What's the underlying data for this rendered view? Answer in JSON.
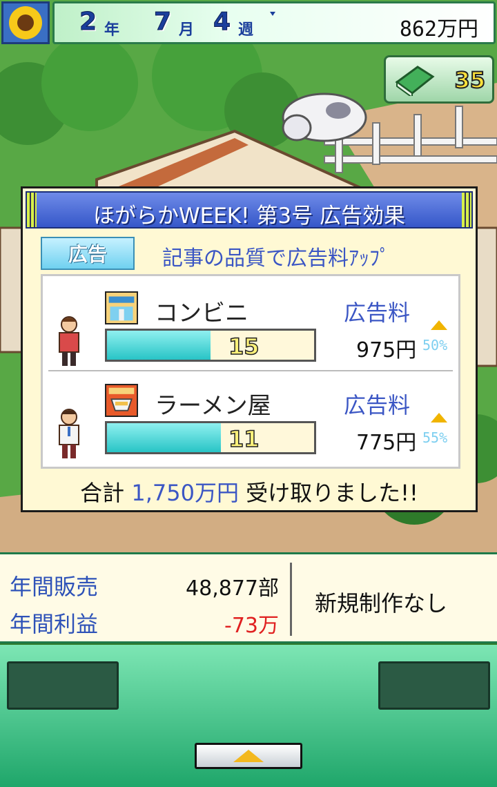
{
  "topbar": {
    "year_num": "2",
    "year_unit": "年",
    "month_num": "7",
    "month_unit": "月",
    "week_num": "4",
    "week_unit": "週",
    "money": "862万円"
  },
  "book_counter": {
    "count": "35",
    "icon": "green-book-icon"
  },
  "dialog": {
    "title": "ほがらかWEEK! 第3号 広告効果",
    "tag": "広告",
    "subtitle": "記事の品質で広告料ｱｯﾌﾟ",
    "rows": [
      {
        "shop": "コンビニ",
        "icon": "convenience-store-icon",
        "fee_label": "広告料",
        "level": "15",
        "level_fill": 0.5,
        "fee": "975円",
        "pct": "50%"
      },
      {
        "shop": "ラーメン屋",
        "icon": "ramen-shop-icon",
        "fee_label": "広告料",
        "level": "11",
        "level_fill": 0.55,
        "fee": "775円",
        "pct": "55%"
      }
    ],
    "total_prefix": "合計",
    "total_amount": "1,750万円",
    "total_suffix": "受け取りました!!"
  },
  "stats": {
    "annual_sales_label": "年間販売",
    "annual_sales_value": "48,877部",
    "annual_profit_label": "年間利益",
    "annual_profit_value": "-73万",
    "status": "新規制作なし"
  },
  "colors": {
    "accent_blue": "#3b56c4",
    "negative_red": "#e02020",
    "bar_cyan": "#28c4c6"
  }
}
